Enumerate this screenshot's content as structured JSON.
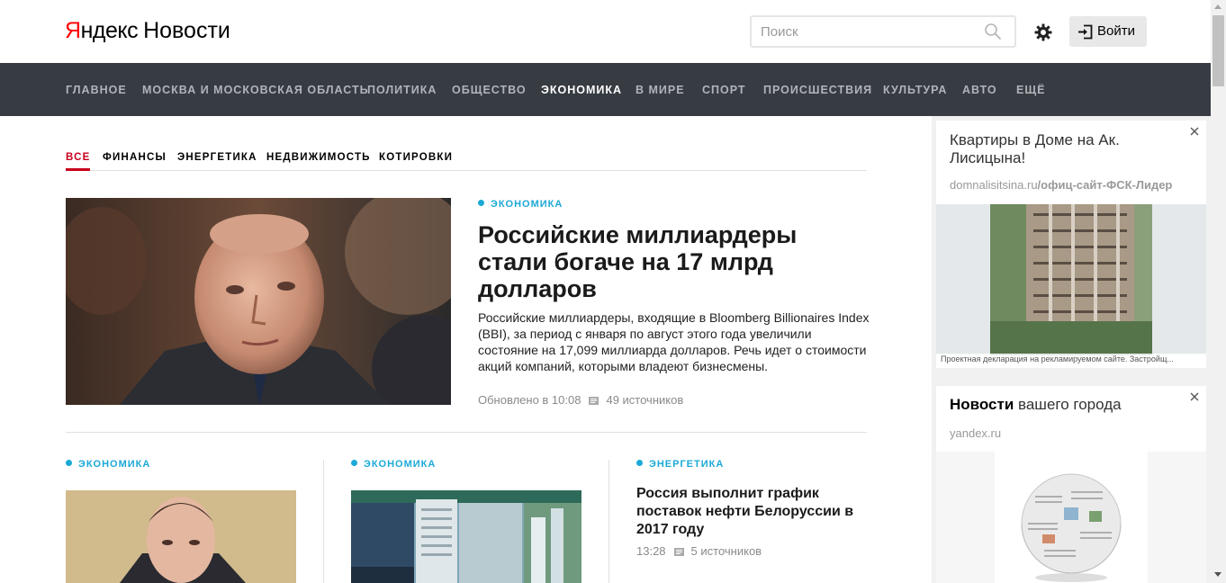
{
  "header": {
    "logo_first_letter": "Я",
    "logo_rest": "ндекс",
    "logo_product": "Новости",
    "search_placeholder": "Поиск",
    "login_label": "Войти"
  },
  "nav": {
    "items": [
      "ГЛАВНОЕ",
      "МОСКВА И МОСКОВСКАЯ ОБЛАСТЬ",
      "ПОЛИТИКА",
      "ОБЩЕСТВО",
      "ЭКОНОМИКА",
      "В МИРЕ",
      "СПОРТ",
      "ПРОИСШЕСТВИЯ",
      "КУЛЬТУРА",
      "АВТО",
      "ЕЩЁ"
    ],
    "active": "ЭКОНОМИКА"
  },
  "subtabs": {
    "items": [
      "ВСЕ",
      "ФИНАНСЫ",
      "ЭНЕРГЕТИКА",
      "НЕДВИЖИМОСТЬ",
      "КОТИРОВКИ"
    ],
    "active": "ВСЕ"
  },
  "main_story": {
    "rubric": "ЭКОНОМИКА",
    "title": "Российские миллиардеры стали богаче на 17 млрд долларов",
    "text": "Российские миллиардеры, входящие в Bloomberg Billionaires Index (BBI), за период с января по август этого года увеличили состояние на 17,099 миллиарда долларов. Речь идет о стоимости акций компаний, которыми владеют бизнесмены.",
    "updated": "Обновлено в 10:08",
    "sources": "49 источников"
  },
  "cards": [
    {
      "rubric": "ЭКОНОМИКА"
    },
    {
      "rubric": "ЭКОНОМИКА"
    },
    {
      "rubric": "ЭНЕРГЕТИКА",
      "title": "Россия выполнит график поставок нефти Белоруссии в 2017 году",
      "time": "13:28",
      "sources": "5 источников"
    }
  ],
  "ads": [
    {
      "title": "Квартиры в Доме на Ак. Лисицына!",
      "domain_host": "domnalisitsina.ru",
      "domain_path": "/офиц-сайт-ФСК-Лидер",
      "disclaimer": "Проектная декларация на рекламируемом сайте. Застройщ..."
    },
    {
      "title_bold": "Новости",
      "title_rest": " вашего города",
      "domain": "yandex.ru"
    }
  ],
  "colors": {
    "nav_bg": "#373b42",
    "accent_red": "#c7001b",
    "rubric_blue": "#1ba9d6"
  }
}
